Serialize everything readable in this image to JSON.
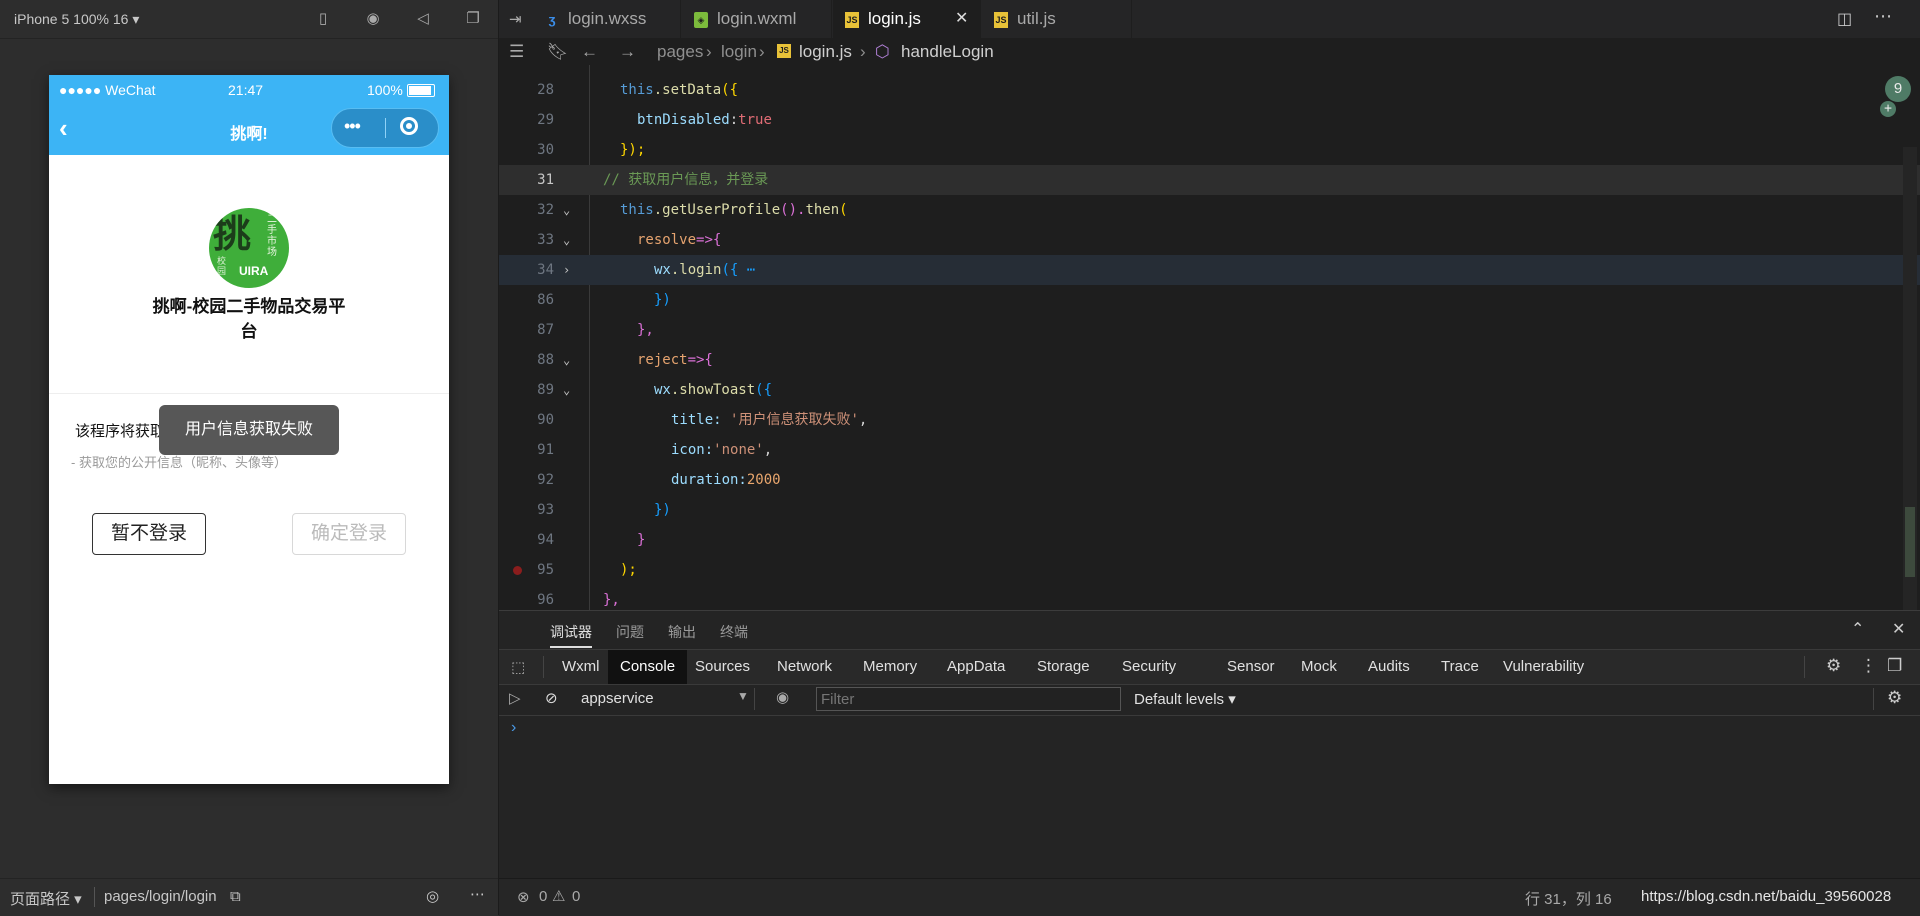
{
  "simulator": {
    "device_label": "iPhone 5 100% 16 ▾",
    "status_bar": {
      "carrier": "●●●●● WeChat",
      "time": "21:47",
      "battery": "100%"
    },
    "nav_title": "挑啊!",
    "logo_text": "挑 二手市场 校园 UIRA",
    "app_name": "挑啊-校园二手物品交易平台",
    "permission_title": "该程序将获取以",
    "permission_sub": "- 获取您的公开信息（昵称、头像等）",
    "toast": "用户信息获取失败",
    "btn_skip": "暂不登录",
    "btn_confirm": "确定登录",
    "bottom": {
      "path_label": "页面路径 ▾",
      "path": "pages/login/login"
    }
  },
  "editor": {
    "tabs": [
      {
        "label": "login.wxss",
        "icon": "css-icon"
      },
      {
        "label": "login.wxml",
        "icon": "wxml-icon"
      },
      {
        "label": "login.js",
        "icon": "js-icon"
      },
      {
        "label": "util.js",
        "icon": "js-icon"
      }
    ],
    "breadcrumb": {
      "p1": "pages",
      "p2": "login",
      "p3": "login.js",
      "p4": "handleLogin"
    },
    "minimap_badge": "9",
    "line_numbers": [
      "28",
      "29",
      "30",
      "31",
      "32",
      "33",
      "34",
      "86",
      "87",
      "88",
      "89",
      "90",
      "91",
      "92",
      "93",
      "94",
      "95",
      "96"
    ],
    "code": {
      "l28_this": "this",
      "l28_fn": ".setData",
      "l28_br": "({",
      "l29_prop": "btnDisabled",
      "l29_val": "true",
      "l30": "});",
      "l31": "// 获取用户信息，并登录",
      "l32_this": "this",
      "l32_fn": ".getUserProfile",
      "l32_mid": "().",
      "l32_then": "then",
      "l32_br": "(",
      "l33_name": "resolve",
      "l33_arrow": "=>{",
      "l34_obj": "wx",
      "l34_fn": ".login",
      "l34_rest": "({ ⋯",
      "l86": "})",
      "l87": "},",
      "l88_name": "reject",
      "l88_arrow": "=>{",
      "l89_obj": "wx",
      "l89_fn": ".showToast",
      "l89_br": "({",
      "l90_key": "title: ",
      "l90_val": "'用户信息获取失败'",
      "l91_key": "icon:",
      "l91_val": "'none'",
      "l92_key": "duration:",
      "l92_val": "2000",
      "l93": "})",
      "l94": "}",
      "l95": ");",
      "l96": "},"
    }
  },
  "devtools": {
    "top_tabs": [
      "调试器",
      "问题",
      "输出",
      "终端"
    ],
    "tabs": [
      "Wxml",
      "Console",
      "Sources",
      "Network",
      "Memory",
      "AppData",
      "Storage",
      "Security",
      "Sensor",
      "Mock",
      "Audits",
      "Trace",
      "Vulnerability"
    ],
    "context": "appservice",
    "filter_placeholder": "Filter",
    "levels": "Default levels ▾",
    "prompt": "›"
  },
  "statusbar": {
    "errors": "0",
    "warnings": "0",
    "position": "行 31，列 16",
    "watermark": "https://blog.csdn.net/baidu_39560028"
  }
}
